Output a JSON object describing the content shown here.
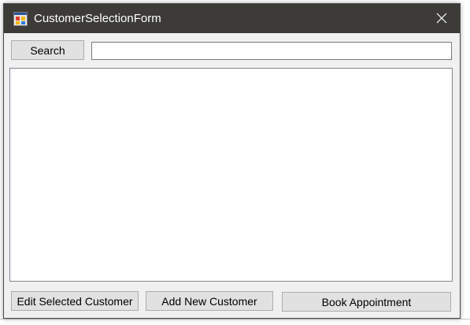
{
  "window": {
    "title": "CustomerSelectionForm"
  },
  "icons": {
    "app": "windows-form-icon",
    "close": "close-icon"
  },
  "toolbar": {
    "search_label": "Search",
    "search_value": ""
  },
  "actions": {
    "edit_label": "Edit Selected Customer",
    "add_label": "Add New Customer",
    "book_label": "Book Appointment"
  },
  "colors": {
    "titlebar": "#3c3b37",
    "window_bg": "#f0f0f0",
    "button_bg": "#e1e1e1"
  }
}
